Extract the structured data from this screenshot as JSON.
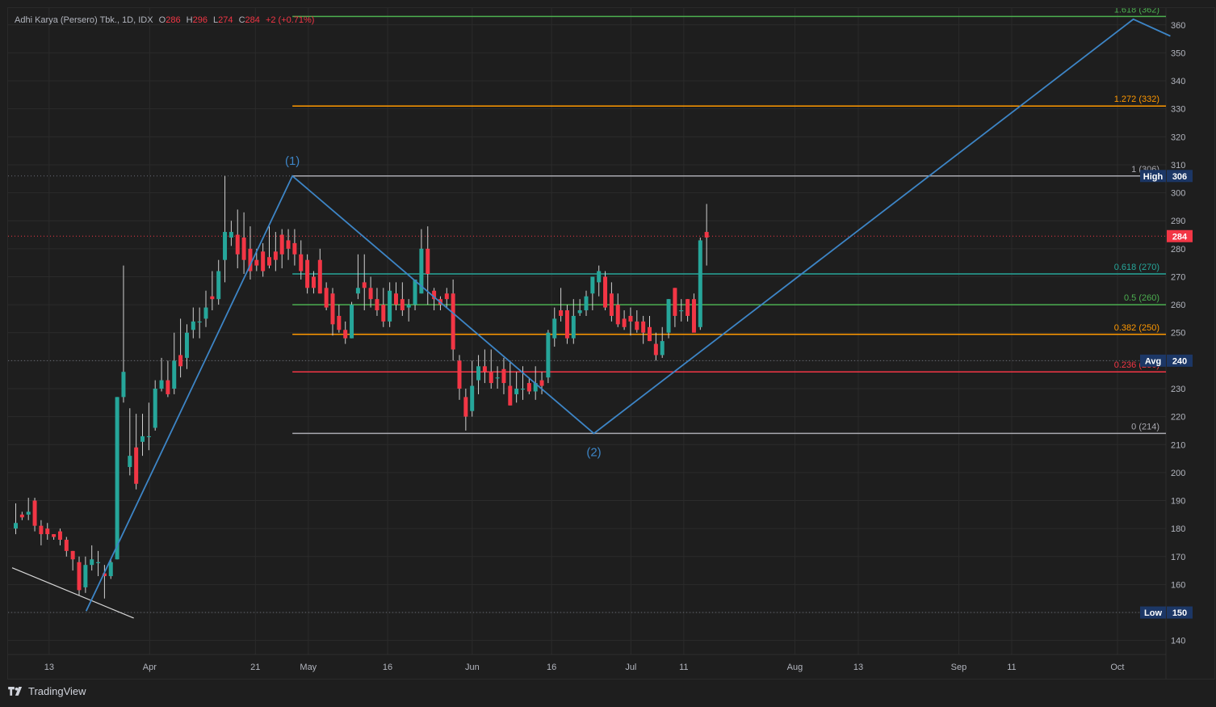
{
  "header": {
    "symbol": "Adhi Karya (Persero) Tbk., 1D, IDX",
    "open_label": "O",
    "open": "286",
    "high_label": "H",
    "high": "296",
    "low_label": "L",
    "low": "274",
    "close_label": "C",
    "close": "284",
    "change": "+2 (+0.71%)"
  },
  "footer": {
    "brand": "TradingView",
    "logo_icon": "tradingview-logo-icon"
  },
  "colors": {
    "background": "#1e1e1e",
    "grid": "#2b2b2b",
    "up": "#26a69a",
    "down": "#f23645",
    "wave_line": "#3d85c6",
    "axis_text": "#b2b5be",
    "badge": "#1c3766",
    "price_badge": "#f23645"
  },
  "chart_data": {
    "type": "candlestick",
    "ylim": [
      135,
      366
    ],
    "y_ticks": [
      140,
      150,
      160,
      170,
      180,
      190,
      200,
      210,
      220,
      230,
      240,
      250,
      260,
      270,
      280,
      290,
      300,
      310,
      320,
      330,
      340,
      350,
      360
    ],
    "x_labels": [
      {
        "label": "13",
        "x": "2024-03-13"
      },
      {
        "label": "Apr",
        "x": "2024-04-01"
      },
      {
        "label": "21",
        "x": "2024-04-21"
      },
      {
        "label": "May",
        "x": "2024-05-01"
      },
      {
        "label": "16",
        "x": "2024-05-16"
      },
      {
        "label": "Jun",
        "x": "2024-06-01"
      },
      {
        "label": "16",
        "x": "2024-06-16"
      },
      {
        "label": "Jul",
        "x": "2024-07-01"
      },
      {
        "label": "11",
        "x": "2024-07-11"
      },
      {
        "label": "Aug",
        "x": "2024-08-01"
      },
      {
        "label": "13",
        "x": "2024-08-13"
      },
      {
        "label": "Sep",
        "x": "2024-09-01"
      },
      {
        "label": "11",
        "x": "2024-09-11"
      },
      {
        "label": "Oct",
        "x": "2024-10-01"
      }
    ],
    "candles": [
      {
        "o": 180,
        "h": 189,
        "l": 178,
        "c": 182
      },
      {
        "o": 185,
        "h": 186,
        "l": 183,
        "c": 184
      },
      {
        "o": 185,
        "h": 191,
        "l": 183,
        "c": 186
      },
      {
        "o": 190,
        "h": 191,
        "l": 179,
        "c": 181
      },
      {
        "o": 181,
        "h": 183,
        "l": 174,
        "c": 178
      },
      {
        "o": 180,
        "h": 182,
        "l": 176,
        "c": 178
      },
      {
        "o": 178,
        "h": 178,
        "l": 176,
        "c": 177
      },
      {
        "o": 179,
        "h": 180,
        "l": 174,
        "c": 176
      },
      {
        "o": 176,
        "h": 177,
        "l": 170,
        "c": 172
      },
      {
        "o": 172,
        "h": 172,
        "l": 165,
        "c": 169
      },
      {
        "o": 168,
        "h": 170,
        "l": 156,
        "c": 158
      },
      {
        "o": 159,
        "h": 170,
        "l": 157,
        "c": 167
      },
      {
        "o": 167,
        "h": 174,
        "l": 165,
        "c": 169
      },
      {
        "o": 168,
        "h": 172,
        "l": 163,
        "c": 168
      },
      {
        "o": 164,
        "h": 167,
        "l": 155,
        "c": 163
      },
      {
        "o": 163,
        "h": 169,
        "l": 162,
        "c": 168
      },
      {
        "o": 169,
        "h": 227,
        "l": 169,
        "c": 227
      },
      {
        "o": 227,
        "h": 274,
        "l": 225,
        "c": 236
      },
      {
        "o": 202,
        "h": 223,
        "l": 199,
        "c": 206
      },
      {
        "o": 209,
        "h": 221,
        "l": 194,
        "c": 196
      },
      {
        "o": 211,
        "h": 221,
        "l": 206,
        "c": 213
      },
      {
        "o": 213,
        "h": 225,
        "l": 208,
        "c": 213
      },
      {
        "o": 216,
        "h": 233,
        "l": 215,
        "c": 230
      },
      {
        "o": 230,
        "h": 241,
        "l": 229,
        "c": 233
      },
      {
        "o": 233,
        "h": 240,
        "l": 227,
        "c": 228
      },
      {
        "o": 230,
        "h": 250,
        "l": 228,
        "c": 240
      },
      {
        "o": 242,
        "h": 255,
        "l": 234,
        "c": 238
      },
      {
        "o": 241,
        "h": 253,
        "l": 237,
        "c": 250
      },
      {
        "o": 251,
        "h": 259,
        "l": 248,
        "c": 254
      },
      {
        "o": 254,
        "h": 259,
        "l": 248,
        "c": 254
      },
      {
        "o": 255,
        "h": 265,
        "l": 252,
        "c": 259
      },
      {
        "o": 263,
        "h": 272,
        "l": 258,
        "c": 262
      },
      {
        "o": 262,
        "h": 276,
        "l": 260,
        "c": 272
      },
      {
        "o": 276,
        "h": 306,
        "l": 268,
        "c": 286
      },
      {
        "o": 284,
        "h": 290,
        "l": 281,
        "c": 286
      },
      {
        "o": 285,
        "h": 294,
        "l": 273,
        "c": 278
      },
      {
        "o": 284,
        "h": 293,
        "l": 271,
        "c": 276
      },
      {
        "o": 280,
        "h": 288,
        "l": 269,
        "c": 272
      },
      {
        "o": 276,
        "h": 280,
        "l": 272,
        "c": 274
      },
      {
        "o": 279,
        "h": 282,
        "l": 270,
        "c": 272
      },
      {
        "o": 277,
        "h": 288,
        "l": 273,
        "c": 274
      },
      {
        "o": 279,
        "h": 286,
        "l": 272,
        "c": 276
      },
      {
        "o": 285,
        "h": 287,
        "l": 273,
        "c": 278
      },
      {
        "o": 283,
        "h": 287,
        "l": 276,
        "c": 280
      },
      {
        "o": 282,
        "h": 287,
        "l": 274,
        "c": 278
      },
      {
        "o": 278,
        "h": 283,
        "l": 269,
        "c": 272
      },
      {
        "o": 276,
        "h": 278,
        "l": 264,
        "c": 266
      },
      {
        "o": 270,
        "h": 272,
        "l": 264,
        "c": 266
      },
      {
        "o": 276,
        "h": 280,
        "l": 264,
        "c": 264
      },
      {
        "o": 266,
        "h": 268,
        "l": 258,
        "c": 259
      },
      {
        "o": 264,
        "h": 266,
        "l": 249,
        "c": 253
      },
      {
        "o": 256,
        "h": 260,
        "l": 250,
        "c": 251
      },
      {
        "o": 251,
        "h": 254,
        "l": 246,
        "c": 248
      },
      {
        "o": 248,
        "h": 261,
        "l": 248,
        "c": 260
      },
      {
        "o": 264,
        "h": 278,
        "l": 262,
        "c": 266
      },
      {
        "o": 268,
        "h": 278,
        "l": 258,
        "c": 266
      },
      {
        "o": 266,
        "h": 270,
        "l": 259,
        "c": 262
      },
      {
        "o": 262,
        "h": 266,
        "l": 256,
        "c": 258
      },
      {
        "o": 260,
        "h": 266,
        "l": 252,
        "c": 254
      },
      {
        "o": 254,
        "h": 268,
        "l": 252,
        "c": 265
      },
      {
        "o": 264,
        "h": 268,
        "l": 258,
        "c": 260
      },
      {
        "o": 262,
        "h": 268,
        "l": 256,
        "c": 258
      },
      {
        "o": 259,
        "h": 262,
        "l": 254,
        "c": 260
      },
      {
        "o": 260,
        "h": 268,
        "l": 258,
        "c": 269
      },
      {
        "o": 264,
        "h": 287,
        "l": 264,
        "c": 280
      },
      {
        "o": 280,
        "h": 288,
        "l": 260,
        "c": 271
      },
      {
        "o": 265,
        "h": 266,
        "l": 258,
        "c": 262
      },
      {
        "o": 262,
        "h": 263,
        "l": 258,
        "c": 260
      },
      {
        "o": 264,
        "h": 266,
        "l": 259,
        "c": 262
      },
      {
        "o": 264,
        "h": 269,
        "l": 240,
        "c": 244
      },
      {
        "o": 240,
        "h": 242,
        "l": 226,
        "c": 230
      },
      {
        "o": 227,
        "h": 230,
        "l": 215,
        "c": 220
      },
      {
        "o": 222,
        "h": 240,
        "l": 220,
        "c": 231
      },
      {
        "o": 233,
        "h": 242,
        "l": 228,
        "c": 238
      },
      {
        "o": 238,
        "h": 244,
        "l": 232,
        "c": 236
      },
      {
        "o": 236,
        "h": 244,
        "l": 230,
        "c": 232
      },
      {
        "o": 234,
        "h": 238,
        "l": 230,
        "c": 234
      },
      {
        "o": 237,
        "h": 241,
        "l": 228,
        "c": 232
      },
      {
        "o": 231,
        "h": 240,
        "l": 224,
        "c": 224
      },
      {
        "o": 228,
        "h": 236,
        "l": 225,
        "c": 230
      },
      {
        "o": 230,
        "h": 238,
        "l": 226,
        "c": 230
      },
      {
        "o": 232,
        "h": 234,
        "l": 228,
        "c": 229
      },
      {
        "o": 229,
        "h": 238,
        "l": 226,
        "c": 232
      },
      {
        "o": 233,
        "h": 236,
        "l": 228,
        "c": 231
      },
      {
        "o": 234,
        "h": 251,
        "l": 232,
        "c": 250
      },
      {
        "o": 248,
        "h": 259,
        "l": 245,
        "c": 255
      },
      {
        "o": 258,
        "h": 266,
        "l": 254,
        "c": 256
      },
      {
        "o": 258,
        "h": 260,
        "l": 246,
        "c": 248
      },
      {
        "o": 248,
        "h": 262,
        "l": 246,
        "c": 256
      },
      {
        "o": 257,
        "h": 262,
        "l": 256,
        "c": 258
      },
      {
        "o": 258,
        "h": 265,
        "l": 256,
        "c": 263
      },
      {
        "o": 264,
        "h": 270,
        "l": 258,
        "c": 270
      },
      {
        "o": 268,
        "h": 274,
        "l": 263,
        "c": 272
      },
      {
        "o": 270,
        "h": 272,
        "l": 258,
        "c": 259
      },
      {
        "o": 264,
        "h": 268,
        "l": 254,
        "c": 256
      },
      {
        "o": 260,
        "h": 264,
        "l": 252,
        "c": 253
      },
      {
        "o": 255,
        "h": 258,
        "l": 251,
        "c": 252
      },
      {
        "o": 256,
        "h": 259,
        "l": 249,
        "c": 254
      },
      {
        "o": 254,
        "h": 258,
        "l": 250,
        "c": 251
      },
      {
        "o": 254,
        "h": 256,
        "l": 246,
        "c": 250
      },
      {
        "o": 252,
        "h": 256,
        "l": 247,
        "c": 247
      },
      {
        "o": 246,
        "h": 250,
        "l": 240,
        "c": 242
      },
      {
        "o": 242,
        "h": 252,
        "l": 241,
        "c": 247
      },
      {
        "o": 250,
        "h": 262,
        "l": 248,
        "c": 262
      },
      {
        "o": 266,
        "h": 266,
        "l": 252,
        "c": 256
      },
      {
        "o": 258,
        "h": 262,
        "l": 254,
        "c": 258
      },
      {
        "o": 262,
        "h": 262,
        "l": 254,
        "c": 256
      },
      {
        "o": 262,
        "h": 264,
        "l": 252,
        "c": 250
      },
      {
        "o": 252,
        "h": 284,
        "l": 251,
        "c": 283
      },
      {
        "o": 286,
        "h": 296,
        "l": 274,
        "c": 284
      }
    ],
    "first_candle_date": "2024-03-06",
    "fib_levels": [
      {
        "label": "0 (214)",
        "value": 214,
        "color": "#a9a9b0"
      },
      {
        "label": "0.236 (236)",
        "value": 236,
        "color": "#f23645"
      },
      {
        "label": "0.382 (250)",
        "value": 249.4,
        "color": "#ff9800"
      },
      {
        "label": "0.5 (260)",
        "value": 260,
        "color": "#4caf50"
      },
      {
        "label": "0.618 (270)",
        "value": 271,
        "color": "#26a69a"
      },
      {
        "label": "1 (306)",
        "value": 306,
        "color": "#a9a9b0"
      },
      {
        "label": "1.272 (332)",
        "value": 331,
        "color": "#ff9800"
      },
      {
        "label": "1.618 (362)",
        "value": 363,
        "color": "#4caf50"
      }
    ],
    "price_lines": [
      {
        "label": "High",
        "value": 306,
        "price": "306"
      },
      {
        "label": "Avg",
        "value": 240,
        "price": "240"
      },
      {
        "label": "Low",
        "value": 150,
        "price": "150"
      }
    ],
    "last_price": {
      "value": 284.5,
      "price": "284"
    },
    "wave_labels": [
      {
        "label": "(1)",
        "x": "2024-04-28",
        "y": 306,
        "pos": "above"
      },
      {
        "label": "(2)",
        "x": "2024-06-24",
        "y": 214,
        "pos": "below"
      }
    ],
    "wave_path": [
      {
        "x": "2024-03-20",
        "y": 150.5
      },
      {
        "x": "2024-04-28",
        "y": 306
      },
      {
        "x": "2024-06-24",
        "y": 214
      },
      {
        "x": "2024-10-04",
        "y": 362
      },
      {
        "x": "2024-10-11",
        "y": 356
      }
    ],
    "trend_line": [
      {
        "x": "2024-03-06",
        "y": 166
      },
      {
        "x": "2024-03-29",
        "y": 148
      }
    ]
  }
}
